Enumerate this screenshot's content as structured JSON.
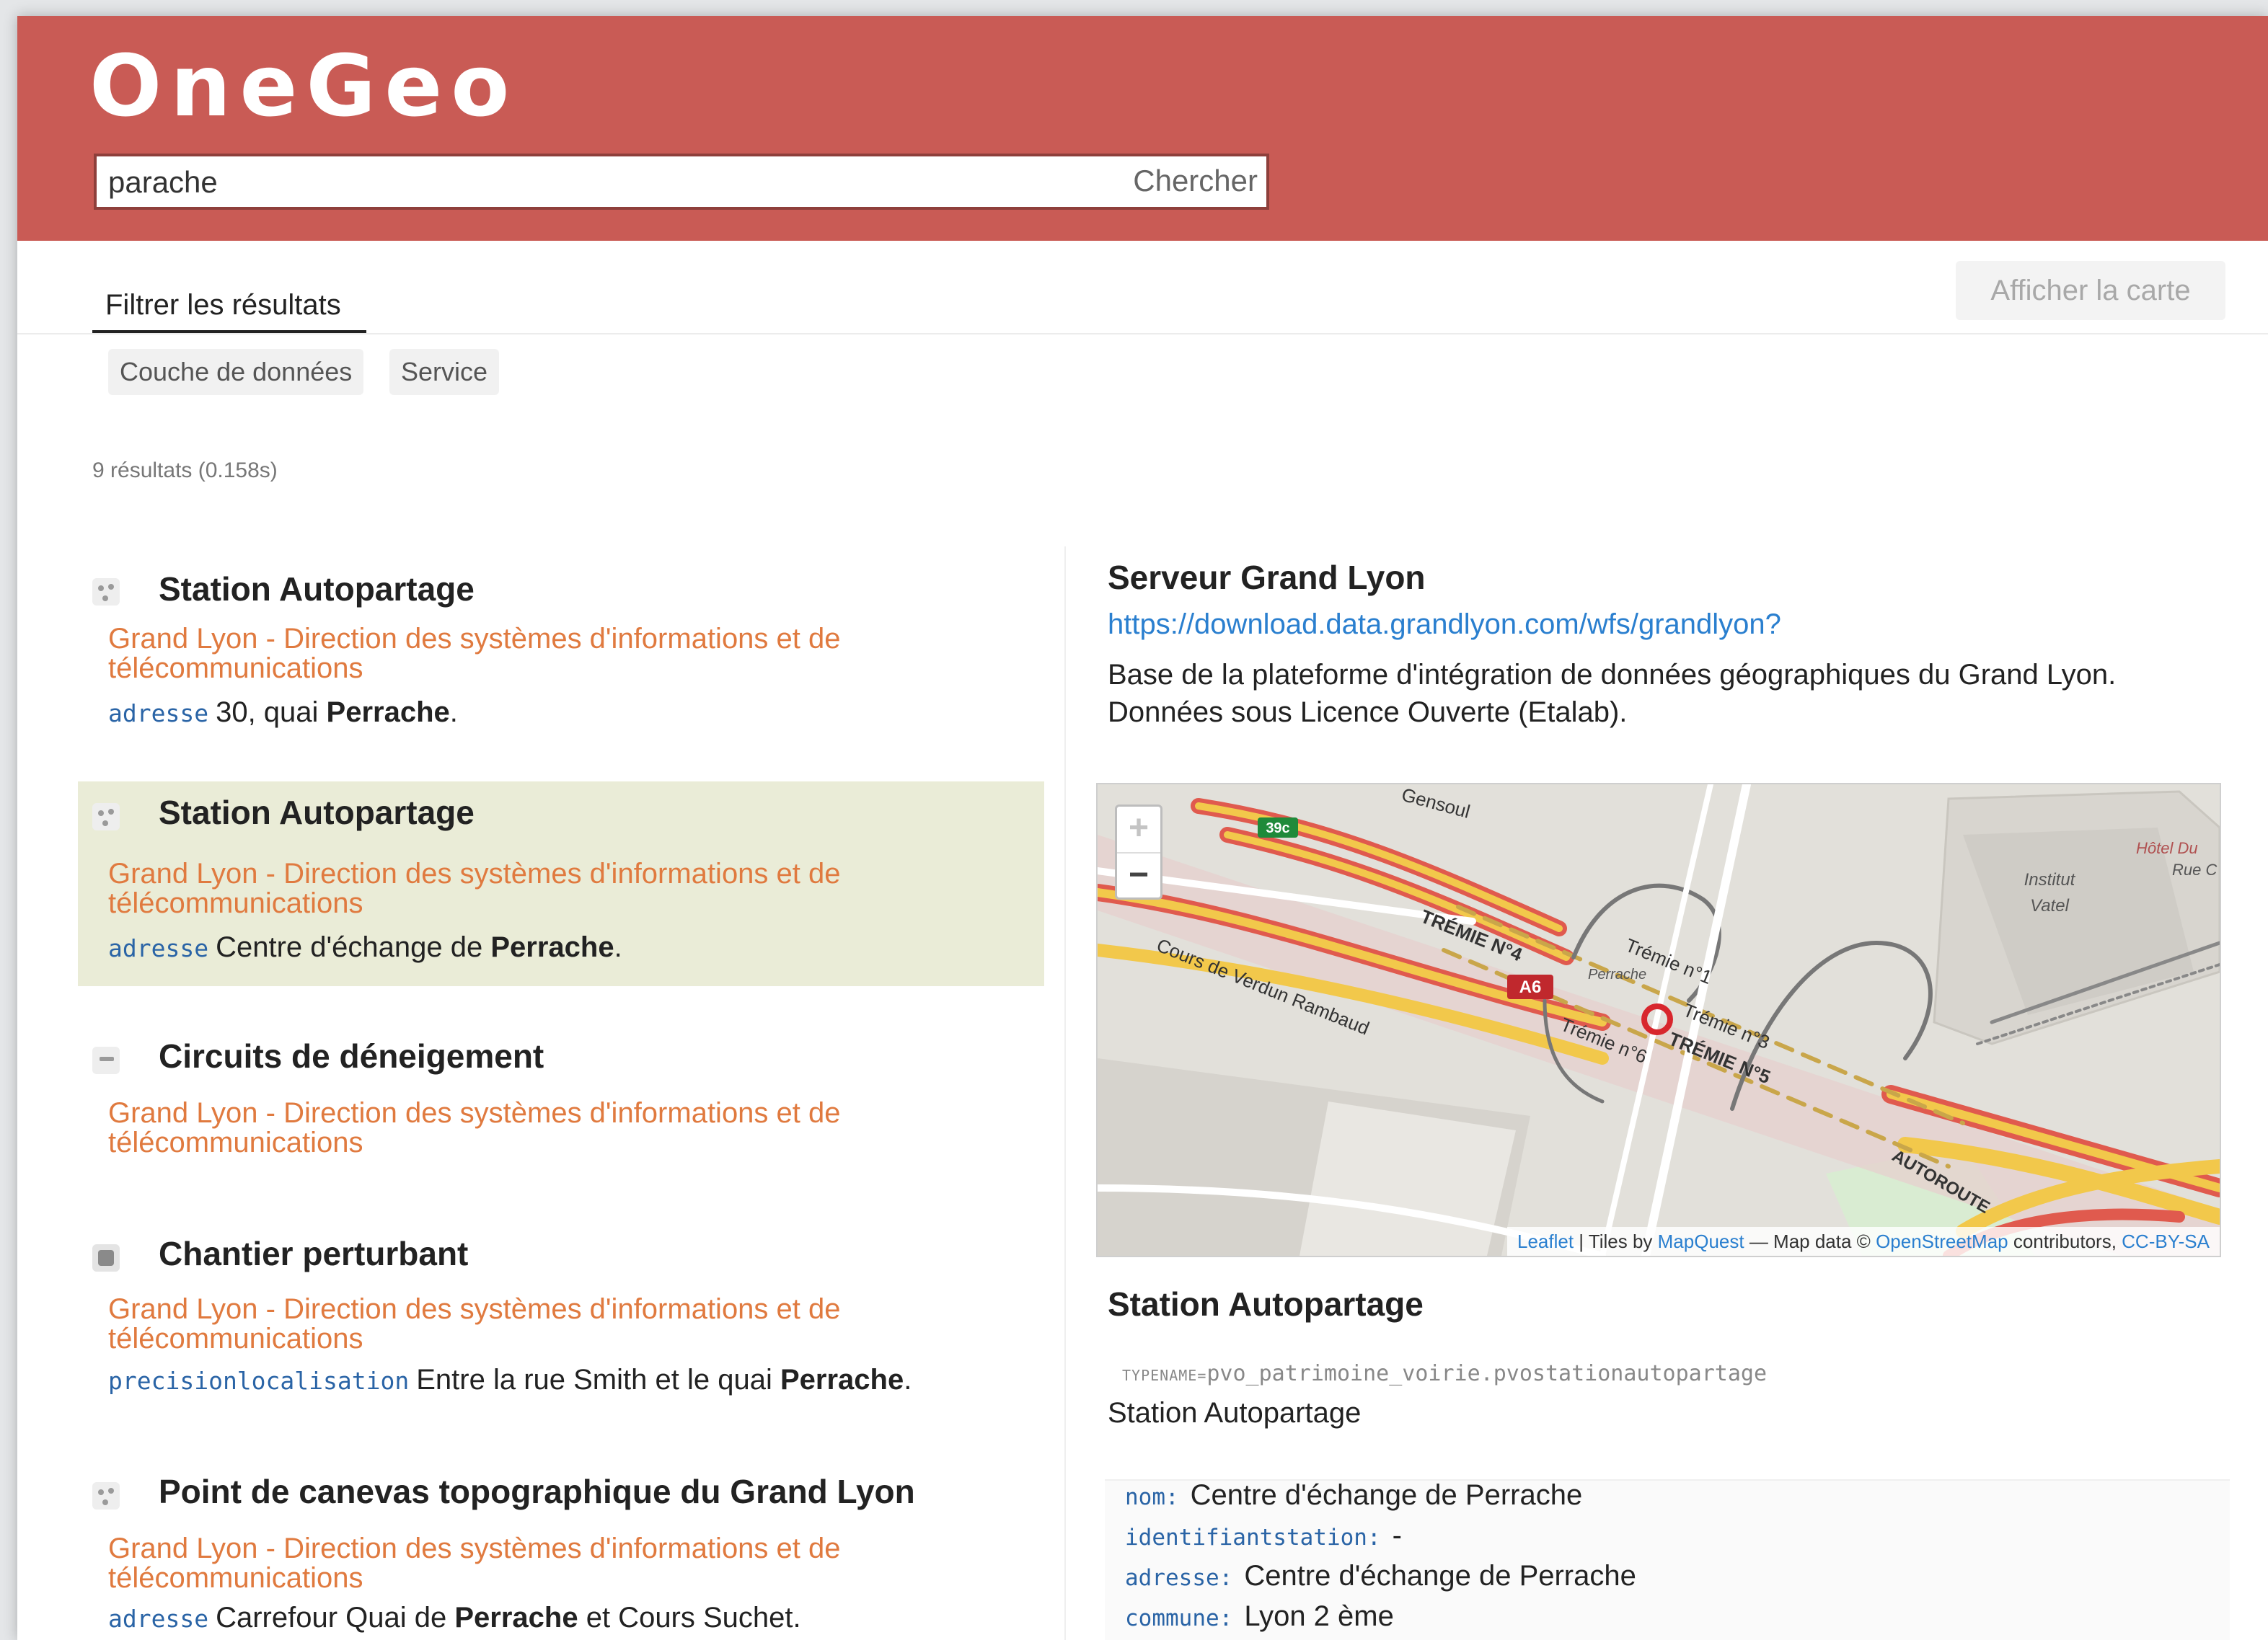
{
  "app": {
    "logo": "OneGeo"
  },
  "search": {
    "value": "parache",
    "button": "Chercher"
  },
  "filters": {
    "tab_label": "Filtrer les résultats",
    "show_map": "Afficher la carte",
    "chips": [
      "Couche de données",
      "Service"
    ]
  },
  "results_count": "9 résultats (0.158s)",
  "results": [
    {
      "title": "Station Autopartage",
      "org": "Grand Lyon - Direction des systèmes d'informations et de télécommunications",
      "attr_key": "adresse",
      "attr_pre": "30, quai ",
      "attr_bold": "Perrache",
      "attr_post": ".",
      "icon": "point-marker-icon"
    },
    {
      "title": "Station Autopartage",
      "org": "Grand Lyon - Direction des systèmes d'informations et de télécommunications",
      "attr_key": "adresse",
      "attr_pre": "Centre d'échange de ",
      "attr_bold": "Perrache",
      "attr_post": ".",
      "icon": "point-marker-icon",
      "selected": true
    },
    {
      "title": "Circuits de déneigement",
      "org": "Grand Lyon - Direction des systèmes d'informations et de télécommunications",
      "icon": "line-layer-icon"
    },
    {
      "title": "Chantier perturbant",
      "org": "Grand Lyon - Direction des systèmes d'informations et de télécommunications",
      "attr_key": "precisionlocalisation",
      "attr_pre": "Entre la rue Smith et le quai ",
      "attr_bold": "Perrache",
      "attr_post": ".",
      "icon": "polygon-layer-icon"
    },
    {
      "title": "Point de canevas topographique du Grand Lyon",
      "org": "Grand Lyon - Direction des systèmes d'informations et de télécommunications",
      "attr_key": "adresse",
      "attr_pre": "Carrefour Quai de ",
      "attr_bold": "Perrache",
      "attr_post": " et Cours Suchet.",
      "icon": "point-marker-icon"
    }
  ],
  "detail": {
    "server_title": "Serveur Grand Lyon",
    "server_url": "https://download.data.grandlyon.com/wfs/grandlyon?",
    "server_desc": "Base de la plateforme d'intégration de données géographiques du Grand Lyon. Données sous Licence Ouverte (Etalab).",
    "layer_title": "Station Autopartage",
    "typename_prefix": "TYPENAME=",
    "typename_value": "pvo_patrimoine_voirie.pvostationautopartage",
    "layer_desc": "Station Autopartage",
    "properties": [
      {
        "key": "nom:",
        "value": "Centre d'échange de Perrache"
      },
      {
        "key": "identifiantstation:",
        "value": "-"
      },
      {
        "key": "adresse:",
        "value": "Centre d'échange de Perrache"
      },
      {
        "key": "commune:",
        "value": "Lyon 2 ème"
      }
    ]
  },
  "map": {
    "zoom_in": "+",
    "zoom_out": "−",
    "attribution": {
      "leaflet": "Leaflet",
      "tiles_by": " | Tiles by ",
      "mapquest": "MapQuest",
      "map_data": " — Map data © ",
      "osm": "OpenStreetMap",
      "contributors": " contributors, ",
      "license": "CC-BY-SA"
    },
    "labels": {
      "gensoul": "Gensoul",
      "sign_39c": "39c",
      "tremie4": "TRÉMIE N°4",
      "tremie1": "Trémie n°1",
      "cours": "Cours de Verdun Rambaud",
      "a6": "A6",
      "tremie3": "Trémie n°3",
      "tremie6": "Trémie n°6",
      "tremie5": "TRÉMIE N°5",
      "autoroute": "AUTOROUTE",
      "institut": "Institut",
      "vatel": "Vatel",
      "hotel": "Hôtel Du",
      "rue_c": "Rue C",
      "perrache": "Perrache"
    },
    "colors": {
      "motorway_fill": "#f2c84b",
      "motorway_red": "#e05a4e",
      "marker": "#d8262d"
    }
  }
}
